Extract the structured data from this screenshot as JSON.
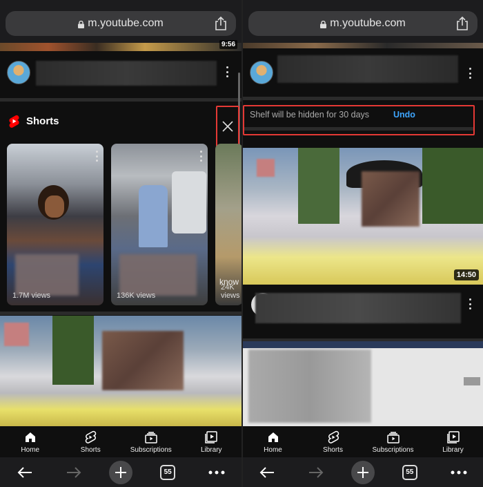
{
  "left": {
    "url": "m.youtube.com",
    "top_duration": "9:56",
    "shorts": {
      "title": "Shorts",
      "cards": [
        {
          "views": "1.7M views"
        },
        {
          "views": "136K views"
        },
        {
          "views": "24K views",
          "title_fragment": "know"
        }
      ]
    }
  },
  "right": {
    "url": "m.youtube.com",
    "shelf_hidden_text": "Shelf will be hidden for 30 days",
    "undo_label": "Undo",
    "video_duration": "14:50"
  },
  "nav": {
    "home": "Home",
    "shorts": "Shorts",
    "subscriptions": "Subscriptions",
    "library": "Library"
  },
  "browser": {
    "tab_count": "55"
  },
  "colors": {
    "highlight": "#e53935",
    "undo": "#3ea6ff",
    "shorts_red": "#ff0000"
  }
}
